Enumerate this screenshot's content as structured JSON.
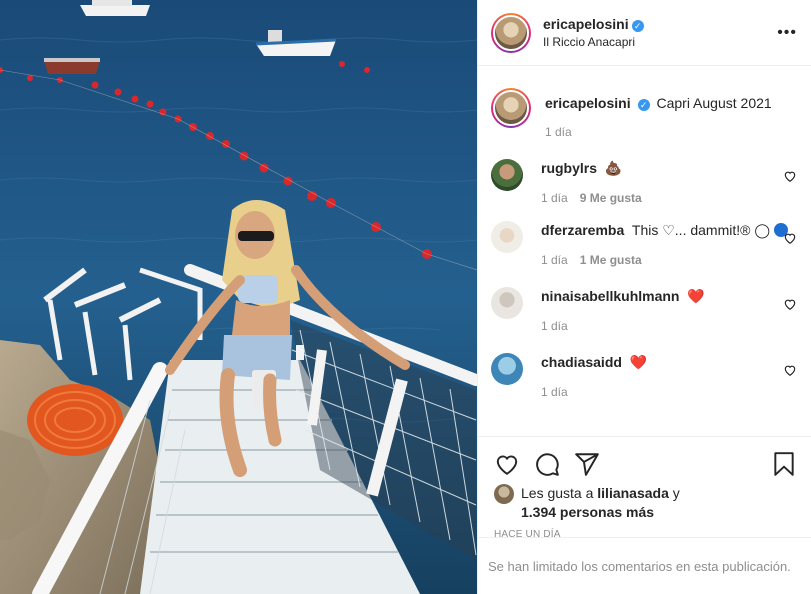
{
  "post": {
    "username": "ericapelosini",
    "location": "Il Riccio Anacapri",
    "more_label": "•••",
    "caption": "Capri August 2021",
    "caption_time": "1 día"
  },
  "comments": [
    {
      "username": "rugbylrs",
      "text": "💩",
      "time": "1 día",
      "likes": "9 Me gusta"
    },
    {
      "username": "dferzaremba",
      "text": "This ♡... dammit!® ◯",
      "time": "1 día",
      "likes": "1 Me gusta"
    },
    {
      "username": "ninaisabellkuhlmann",
      "text": "❤️",
      "time": "1 día",
      "likes": ""
    },
    {
      "username": "chadiasaidd",
      "text": "❤️",
      "time": "1 día",
      "likes": ""
    }
  ],
  "actions": {
    "liked_by_prefix": "Les gusta a",
    "liked_by_user": "lilianasada",
    "liked_by_connector": "y",
    "others_count": "1.394 personas más",
    "timestamp": "HACE UN DÍA",
    "comments_limited": "Se han limitado los comentarios en esta publicación."
  },
  "icons": {
    "more": "more-icon",
    "verified": "verified-badge-icon",
    "like": "heart-icon",
    "comment": "comment-icon",
    "share": "send-icon",
    "save": "bookmark-icon"
  },
  "colors": {
    "verified": "#3897f0",
    "heart_red": "#ed4956",
    "secondary_text": "#8e8e8e",
    "border": "#efefef"
  }
}
